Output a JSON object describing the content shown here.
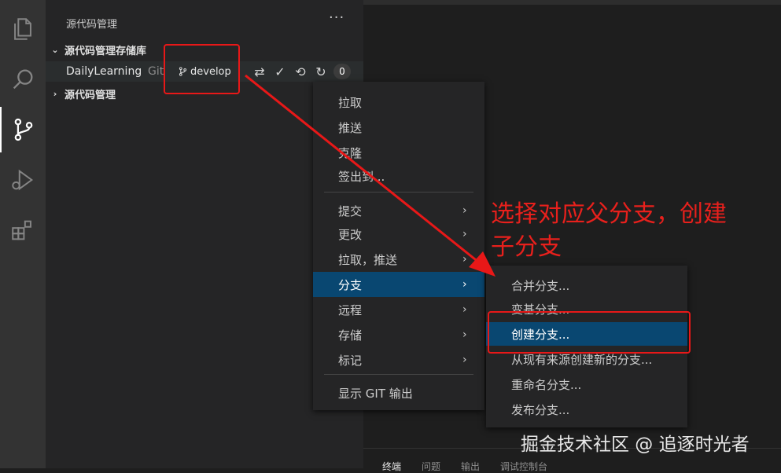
{
  "activity_bar": {
    "items": [
      {
        "icon": "files-icon"
      },
      {
        "icon": "search-icon"
      },
      {
        "icon": "source-control-icon",
        "active": true
      },
      {
        "icon": "run-debug-icon"
      },
      {
        "icon": "extensions-icon"
      }
    ]
  },
  "sidebar": {
    "title": "源代码管理",
    "more_label": "···",
    "repos_section": "源代码管理存储库",
    "repo": {
      "name": "DailyLearning",
      "kind": "Git",
      "branch": "develop",
      "actions_more": "···",
      "badge": "0"
    },
    "scm_section": "源代码管理"
  },
  "context_menu": {
    "items": [
      {
        "label": "拉取"
      },
      {
        "label": "推送"
      },
      {
        "label": "克隆"
      },
      {
        "label": "签出到..."
      },
      {
        "label": "提交",
        "arrow": "›"
      },
      {
        "label": "更改",
        "arrow": "›"
      },
      {
        "label": "拉取，推送",
        "arrow": "›"
      },
      {
        "label": "分支",
        "arrow": "›",
        "selected": true
      },
      {
        "label": "远程",
        "arrow": "›"
      },
      {
        "label": "存储",
        "arrow": "›"
      },
      {
        "label": "标记",
        "arrow": "›"
      },
      {
        "label": "显示 GIT 输出"
      }
    ]
  },
  "branch_submenu": {
    "items": [
      {
        "label": "合并分支..."
      },
      {
        "label": "变基分支..."
      },
      {
        "label": "创建分支...",
        "selected": true
      },
      {
        "label": "从现有来源创建新的分支..."
      },
      {
        "label": "重命名分支..."
      },
      {
        "label": "发布分支..."
      }
    ]
  },
  "panel": {
    "tabs": [
      "终端",
      "问题",
      "输出",
      "调试控制台"
    ]
  },
  "annotation": {
    "text": "选择对应父分支，创建子分支",
    "color": "#e8201c"
  },
  "watermark": "掘金技术社区 @ 追逐时光者",
  "colors": {
    "accent": "#094771",
    "highlight": "#e81818"
  }
}
